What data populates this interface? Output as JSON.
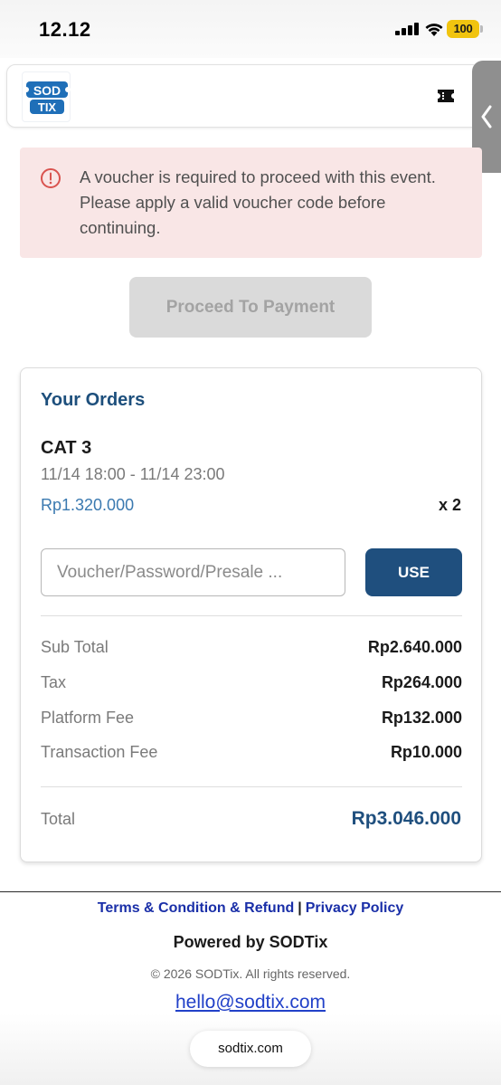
{
  "status_bar": {
    "time": "12.12",
    "battery": "100"
  },
  "header": {
    "logo_text_top": "SOD",
    "logo_text_bottom": "TIX"
  },
  "alert": {
    "message": "A voucher is required to proceed with this event. Please apply a valid voucher code before continuing."
  },
  "proceed_button": {
    "label": "Proceed To Payment",
    "enabled": false
  },
  "orders": {
    "title": "Your Orders",
    "item": {
      "name": "CAT 3",
      "time": "11/14 18:00 - 11/14 23:00",
      "price": "Rp1.320.000",
      "quantity": "x 2"
    },
    "voucher": {
      "placeholder": "Voucher/Password/Presale ...",
      "value": "",
      "button_label": "USE"
    },
    "summary": [
      {
        "label": "Sub Total",
        "value": "Rp2.640.000"
      },
      {
        "label": "Tax",
        "value": "Rp264.000"
      },
      {
        "label": "Platform Fee",
        "value": "Rp132.000"
      },
      {
        "label": "Transaction Fee",
        "value": "Rp10.000"
      }
    ],
    "total": {
      "label": "Total",
      "value": "Rp3.046.000"
    }
  },
  "footer": {
    "terms_link": "Terms & Condition & Refund",
    "separator": "|",
    "privacy_link": "Privacy Policy",
    "powered_by": "Powered by SODTix",
    "copyright": "© 2026 SODTix. All rights reserved.",
    "email": "hello@sodtix.com"
  },
  "browser": {
    "url": "sodtix.com"
  },
  "colors": {
    "brand_blue": "#1f4f7e",
    "alert_bg": "#f9e6e6",
    "alert_icon": "#d9534f",
    "link_blue": "#1a2fa8"
  }
}
